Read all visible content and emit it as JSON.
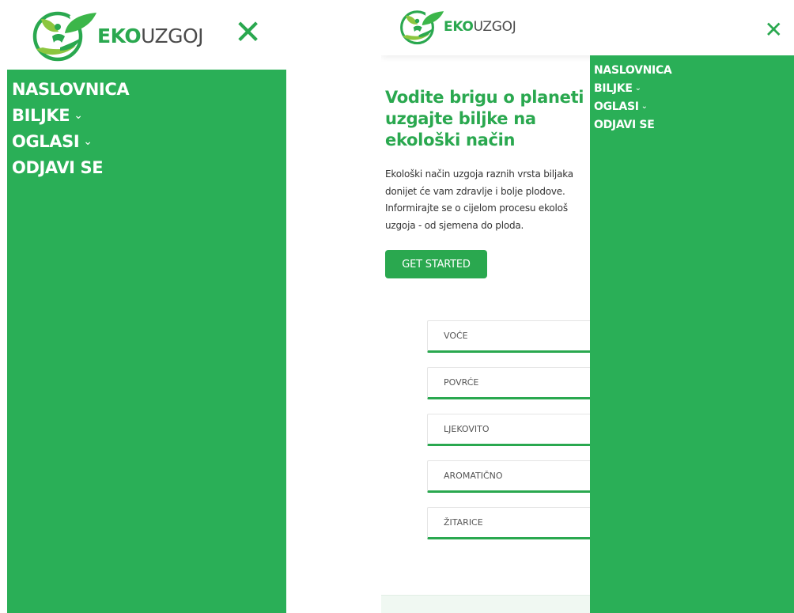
{
  "brand": {
    "prefix": "EKO",
    "suffix": "UZGOJ"
  },
  "colors": {
    "primary": "#2aa84f",
    "menu_bg": "#2aaf57",
    "text": "#333333"
  },
  "close_icon": "✕",
  "chevron_icon": "⌄",
  "left_menu": {
    "items": [
      {
        "label": "NASLOVNICA",
        "has_dropdown": false
      },
      {
        "label": "BILJKE",
        "has_dropdown": true
      },
      {
        "label": "OGLASI",
        "has_dropdown": true
      },
      {
        "label": "ODJAVI SE",
        "has_dropdown": false
      }
    ]
  },
  "right_menu": {
    "items": [
      {
        "label": "NASLOVNICA",
        "has_dropdown": false
      },
      {
        "label": "BILJKE",
        "has_dropdown": true
      },
      {
        "label": "OGLASI",
        "has_dropdown": true
      },
      {
        "label": "ODJAVI SE",
        "has_dropdown": false
      }
    ]
  },
  "hero": {
    "title_lines": [
      "Vodite brigu o planeti",
      "uzgajte biljke na",
      "ekološki način"
    ],
    "text_lines": [
      "Ekološki način uzgoja raznih vrsta biljaka",
      "donijet će vam zdravlje i bolje plodove.",
      "Informirajte se o cijelom procesu ekološ",
      "uzgoja - od sjemena do ploda."
    ],
    "button_label": "GET STARTED"
  },
  "categories": [
    "VOĆE",
    "POVRĆE",
    "LJEKOVITO",
    "AROMATIČNO",
    "ŽITARICE"
  ]
}
